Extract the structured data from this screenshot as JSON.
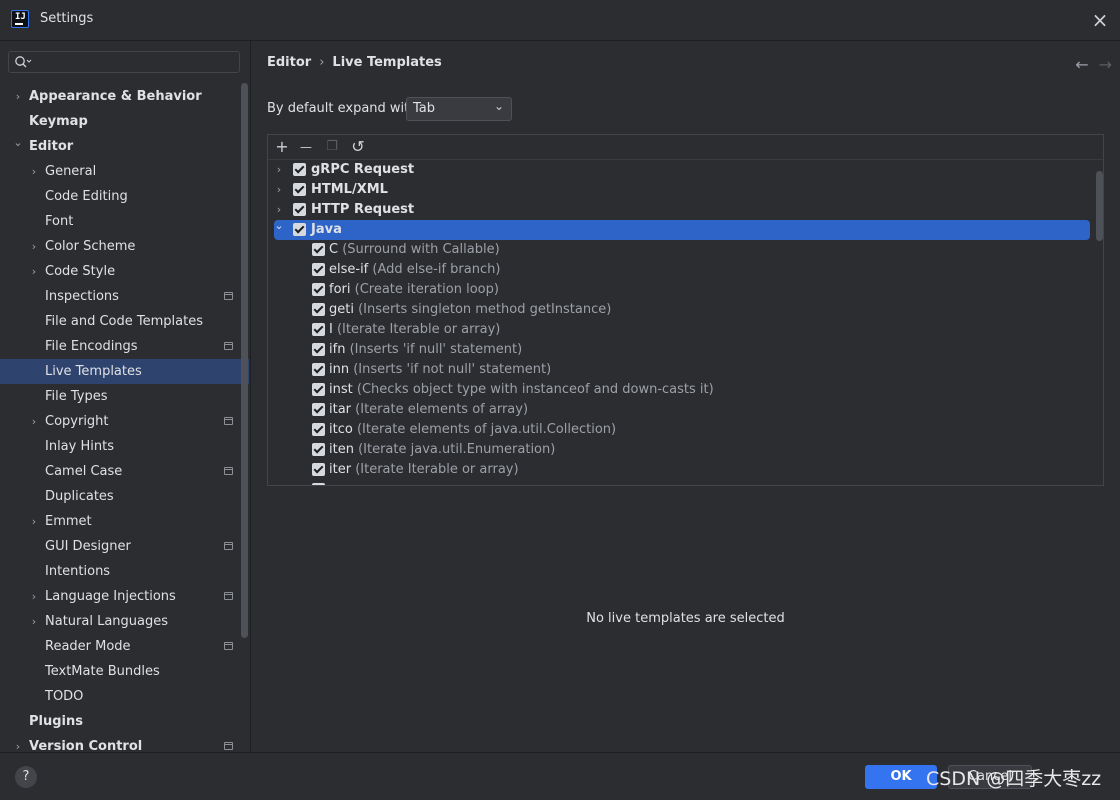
{
  "window": {
    "title": "Settings",
    "app_icon_text": "IJ"
  },
  "sidebar": {
    "search": {
      "placeholder": "",
      "value": ""
    },
    "items": [
      {
        "label": "Appearance & Behavior",
        "chevron": "›"
      },
      {
        "label": "Keymap",
        "chevron": ""
      },
      {
        "label": "Editor",
        "chevron": "⌄"
      },
      {
        "label": "General",
        "chevron": "›"
      },
      {
        "label": "Code Editing",
        "chevron": ""
      },
      {
        "label": "Font",
        "chevron": ""
      },
      {
        "label": "Color Scheme",
        "chevron": "›"
      },
      {
        "label": "Code Style",
        "chevron": "›"
      },
      {
        "label": "Inspections",
        "chevron": ""
      },
      {
        "label": "File and Code Templates",
        "chevron": ""
      },
      {
        "label": "File Encodings",
        "chevron": ""
      },
      {
        "label": "Live Templates",
        "chevron": ""
      },
      {
        "label": "File Types",
        "chevron": ""
      },
      {
        "label": "Copyright",
        "chevron": "›"
      },
      {
        "label": "Inlay Hints",
        "chevron": ""
      },
      {
        "label": "Camel Case",
        "chevron": ""
      },
      {
        "label": "Duplicates",
        "chevron": ""
      },
      {
        "label": "Emmet",
        "chevron": "›"
      },
      {
        "label": "GUI Designer",
        "chevron": ""
      },
      {
        "label": "Intentions",
        "chevron": ""
      },
      {
        "label": "Language Injections",
        "chevron": "›"
      },
      {
        "label": "Natural Languages",
        "chevron": "›"
      },
      {
        "label": "Reader Mode",
        "chevron": ""
      },
      {
        "label": "TextMate Bundles",
        "chevron": ""
      },
      {
        "label": "TODO",
        "chevron": ""
      },
      {
        "label": "Plugins",
        "chevron": ""
      },
      {
        "label": "Version Control",
        "chevron": "›"
      }
    ]
  },
  "main": {
    "breadcrumb": {
      "parent": "Editor",
      "separator": "›",
      "current": "Live Templates"
    },
    "nav": {
      "back": "←",
      "forward": "→"
    },
    "expand": {
      "label": "By default expand with",
      "value": "Tab",
      "arrow": "⌄"
    },
    "toolbar": {
      "add": "+",
      "remove": "—",
      "copy": "❐",
      "restore": "↺"
    },
    "groups": [
      {
        "name": "gRPC Request",
        "chevron": "›"
      },
      {
        "name": "HTML/XML",
        "chevron": "›"
      },
      {
        "name": "HTTP Request",
        "chevron": "›"
      },
      {
        "name": "Java",
        "chevron": "⌄"
      }
    ],
    "templates": [
      {
        "abbr": "C",
        "desc": " (Surround with Callable)"
      },
      {
        "abbr": "else-if",
        "desc": " (Add else-if branch)"
      },
      {
        "abbr": "fori",
        "desc": " (Create iteration loop)"
      },
      {
        "abbr": "geti",
        "desc": " (Inserts singleton method getInstance)"
      },
      {
        "abbr": "I",
        "desc": " (Iterate Iterable or array)"
      },
      {
        "abbr": "ifn",
        "desc": " (Inserts 'if null' statement)"
      },
      {
        "abbr": "inn",
        "desc": " (Inserts 'if not null' statement)"
      },
      {
        "abbr": "inst",
        "desc": " (Checks object type with instanceof and down-casts it)"
      },
      {
        "abbr": "itar",
        "desc": " (Iterate elements of array)"
      },
      {
        "abbr": "itco",
        "desc": " (Iterate elements of java.util.Collection)"
      },
      {
        "abbr": "iten",
        "desc": " (Iterate java.util.Enumeration)"
      },
      {
        "abbr": "iter",
        "desc": " (Iterate Iterable or array)"
      }
    ],
    "empty_message": "No live templates are selected"
  },
  "footer": {
    "help": "?",
    "ok": "OK",
    "cancel": "Cancel",
    "watermark": "CSDN @四季大枣zz"
  },
  "colors": {
    "accent": "#3574f0",
    "selection": "#2e436e",
    "row_selection": "#2e64c8",
    "background": "#2b2d30"
  }
}
